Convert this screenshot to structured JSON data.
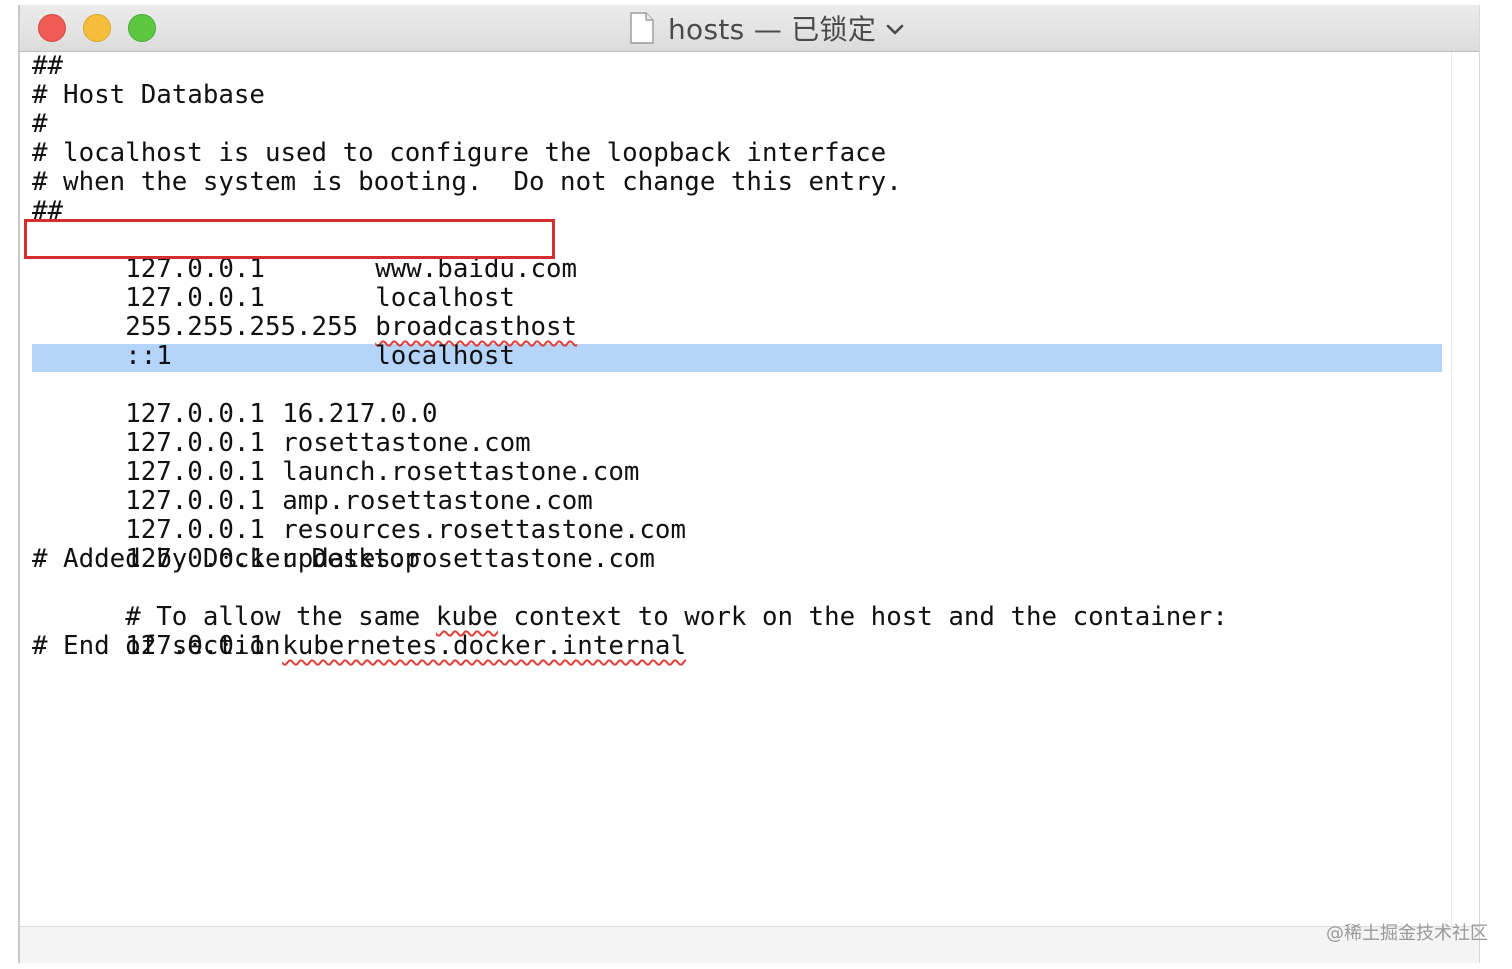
{
  "window": {
    "title": "hosts — 已锁定"
  },
  "editor": {
    "lines": [
      {
        "text": "##"
      },
      {
        "text": "# Host Database"
      },
      {
        "text": "#"
      },
      {
        "text": "# localhost is used to configure the loopback interface"
      },
      {
        "text": "# when the system is booting.  Do not change this entry."
      },
      {
        "text": "##"
      },
      {
        "ip": "127.0.0.1",
        "host": "www.baidu.com"
      },
      {
        "ip": "127.0.0.1",
        "host": "localhost"
      },
      {
        "ip": "255.255.255.255",
        "host": "broadcasthost"
      },
      {
        "ip": "::1",
        "host": "localhost"
      },
      {
        "text": ""
      },
      {
        "ip": "127.0.0.1",
        "host": "16.217.0.0"
      },
      {
        "ip": "127.0.0.1",
        "host": "rosettastone.com"
      },
      {
        "ip": "127.0.0.1",
        "host": "launch.rosettastone.com"
      },
      {
        "ip": "127.0.0.1",
        "host": "amp.rosettastone.com"
      },
      {
        "ip": "127.0.0.1",
        "host": "resources.rosettastone.com"
      },
      {
        "ip": "127.0.0.1",
        "host": "updates.rosettastone.com"
      },
      {
        "text": "# Added by Docker Desktop"
      },
      {
        "text_pre": "# To allow the same ",
        "misspelled": "kube",
        "text_post": " context to work on the host and the container:"
      },
      {
        "ip": "127.0.0.1",
        "host": "kubernetes.docker.internal"
      },
      {
        "text": "# End of section"
      }
    ]
  },
  "watermark": "@稀土掘金技术社区",
  "colors": {
    "highlight_border": "#d62e2e",
    "selection": "#b5d4fa",
    "spellcheck": "#e0403a"
  },
  "icons": {
    "title_icon": "document-icon",
    "title_menu": "chevron-down-icon"
  }
}
